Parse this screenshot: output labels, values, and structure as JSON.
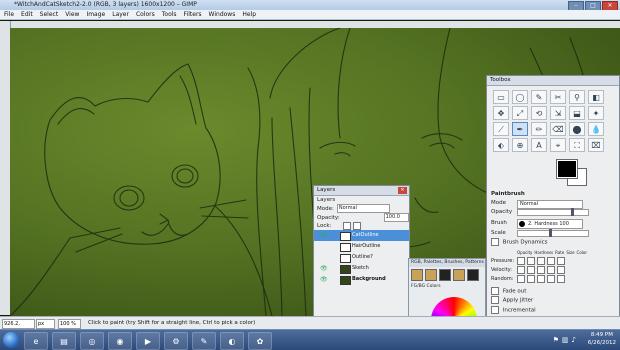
{
  "window": {
    "title": "*WitchAndCatSketch2-2.0 (RGB, 3 layers) 1600x1200 – GIMP",
    "controls": {
      "minimize": "–",
      "maximize": "□",
      "close": "✕"
    }
  },
  "menu": [
    "File",
    "Edit",
    "Select",
    "View",
    "Image",
    "Layer",
    "Colors",
    "Tools",
    "Filters",
    "Windows",
    "Help"
  ],
  "layers_panel": {
    "title": "Layers",
    "close": "✕",
    "section": "Layers",
    "mode_label": "Mode:",
    "mode_value": "Normal",
    "opacity_label": "Opacity:",
    "opacity_value": "100.0",
    "lock_label": "Lock:",
    "layers": [
      {
        "name": "CatOutline",
        "visible": true,
        "selected": true
      },
      {
        "name": "HairOutline",
        "visible": false,
        "selected": false
      },
      {
        "name": "Outline?",
        "visible": false,
        "selected": false
      },
      {
        "name": "Sketch",
        "visible": true,
        "selected": false
      },
      {
        "name": "Background",
        "visible": true,
        "selected": false
      }
    ]
  },
  "toolbox": {
    "title": "Toolbox",
    "tool_options_title": "Paintbrush",
    "mode_label": "Mode",
    "mode_value": "Normal",
    "opacity_label": "Opacity",
    "brush_label": "Brush",
    "brush_value": "2. Hardness 100",
    "scale_label": "Scale",
    "brush_dynamics_label": "Brush Dynamics",
    "dynamics_columns": [
      "Opacity",
      "Hardness",
      "Rate",
      "Size",
      "Color"
    ],
    "dynamics_rows": [
      "Pressure:",
      "Velocity:",
      "Random:"
    ],
    "fade_out_label": "Fade out",
    "apply_jitter_label": "Apply Jitter",
    "incremental_label": "Incremental",
    "tools": [
      "▭",
      "◯",
      "✎",
      "✂",
      "⚲",
      "◧",
      "✥",
      "⤢",
      "⟲",
      "⇲",
      "⬓",
      "✦",
      "⟋",
      "✒",
      "✏",
      "⌫",
      "⬤",
      "💧",
      "⬖",
      "⊕",
      "A",
      "⌖",
      "⛶",
      "⌧"
    ]
  },
  "dock": {
    "tabs": "RGB, Palettes, Brushes, Patterns",
    "header": "FG/BG Colors"
  },
  "status": {
    "coords": "926.2, 817.1",
    "unit": "px",
    "zoom": "100 %",
    "hint": "Click to paint (try Shift for a straight line, Ctrl to pick a color)"
  },
  "taskbar": {
    "time": "8:49 PM",
    "date": "6/26/2012",
    "apps": [
      "ie-icon",
      "folder-icon",
      "chrome-icon",
      "firefox-icon",
      "media-icon",
      "steam-icon",
      "gimp-icon",
      "browser-icon",
      "paint-icon"
    ]
  },
  "colors": {
    "canvas": "#547222",
    "selection": "#4a8fd8"
  }
}
